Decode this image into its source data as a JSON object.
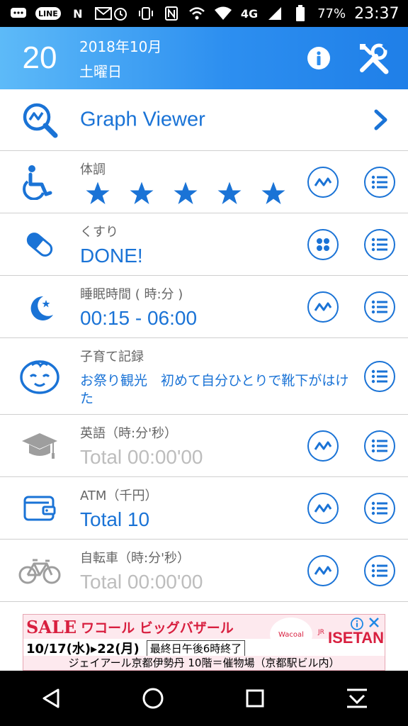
{
  "status_bar": {
    "line_label": "LINE",
    "n_label": "N",
    "network": "4G",
    "battery": "77%",
    "time": "23:37"
  },
  "header": {
    "day": "20",
    "year_month": "2018年10月",
    "weekday": "土曜日"
  },
  "graph_viewer": {
    "label": "Graph Viewer"
  },
  "rows": [
    {
      "label": "体調",
      "rating": 5,
      "rating_max": 5
    },
    {
      "label": "くすり",
      "value": "DONE!"
    },
    {
      "label": "睡眠時間 ( 時:分 )",
      "value": "00:15 - 06:00"
    },
    {
      "label": "子育て記録",
      "note": "お祭り観光　初めて自分ひとりで靴下がはけた"
    },
    {
      "label": "英語（時:分'秒）",
      "value": "Total 00:00'00"
    },
    {
      "label": "ATM（千円）",
      "value": "Total 10"
    },
    {
      "label": "自転車（時:分'秒）",
      "value": "Total 00:00'00"
    }
  ],
  "ad": {
    "sale": "SALE",
    "brand_title": "ワコール ビッグバザール",
    "dates": "10/17",
    "dates_day1": "水",
    "dates_arrow": "▸",
    "dates_end": "22",
    "dates_day2": "月",
    "final_day": "最終日午後6時終了",
    "logo": "Wacoal",
    "jr": "JR",
    "isetan": "ISETAN",
    "location": "ジェイアール京都伊勢丹 10階＝催物場（京都駅ビル内）"
  },
  "colors": {
    "accent": "#1a73d6",
    "header_from": "#5dbaf8",
    "header_to": "#1f7fe8"
  }
}
